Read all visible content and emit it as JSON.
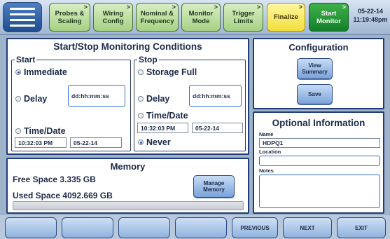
{
  "header": {
    "steps": [
      {
        "label": "Probes &\nScaling",
        "style": "normal"
      },
      {
        "label": "Wiring\nConfig",
        "style": "normal"
      },
      {
        "label": "Nominal &\nFrequency",
        "style": "normal"
      },
      {
        "label": "Monitor\nMode",
        "style": "normal"
      },
      {
        "label": "Trigger\nLimits",
        "style": "normal"
      },
      {
        "label": "Finalize",
        "style": "finalize"
      },
      {
        "label": "Start\nMonitor",
        "style": "start"
      }
    ],
    "arrow_glyph": ">",
    "date": "05-22-14",
    "time": "11:19:48pm"
  },
  "monitoring": {
    "title": "Start/Stop Monitoring Conditions",
    "start": {
      "legend": "Start",
      "immediate_label": "Immediate",
      "delay_label": "Delay",
      "delay_value": "dd:hh:mm:ss",
      "timedate_label": "Time/Date",
      "time_value": "10:32:03 PM",
      "date_value": "05-22-14",
      "selected": "immediate"
    },
    "stop": {
      "legend": "Stop",
      "storage_label": "Storage Full",
      "delay_label": "Delay",
      "delay_value": "dd:hh:mm:ss",
      "timedate_label": "Time/Date",
      "time_value": "10:32:03 PM",
      "date_value": "05-22-14",
      "never_label": "Never",
      "selected": "never"
    }
  },
  "memory": {
    "title": "Memory",
    "free_label": "Free Space",
    "free_value": "3.335 GB",
    "used_label": "Used Space",
    "used_value": "4092.669 GB",
    "manage_button": "Manage\nMemory",
    "used_fraction": 0.0
  },
  "configuration": {
    "title": "Configuration",
    "view_button": "View\nSummary",
    "save_button": "Save"
  },
  "optional": {
    "title": "Optional Information",
    "name_label": "Name",
    "name_value": "HDPQ1",
    "location_label": "Location",
    "location_value": "",
    "notes_label": "Notes",
    "notes_value": ""
  },
  "footer": {
    "buttons": [
      "",
      "",
      "",
      "",
      "PREVIOUS",
      "NEXT",
      "EXIT"
    ]
  },
  "colors": {
    "panel_border": "#1f3c79",
    "step_green": "#a6d184",
    "finalize_yellow": "#f2df3c",
    "start_green": "#13802a"
  }
}
